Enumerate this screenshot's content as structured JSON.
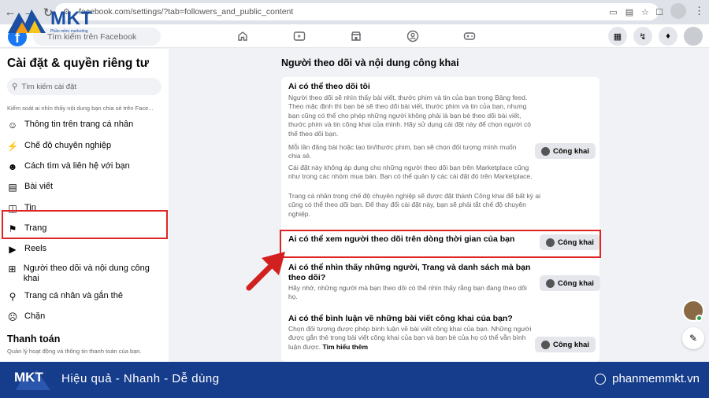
{
  "browser": {
    "url": "facebook.com/settings/?tab=followers_and_public_content",
    "nav_icons": [
      "back-arrow-icon",
      "forward-arrow-icon",
      "reload-icon"
    ]
  },
  "watermark": {
    "brand": "MKT",
    "sub": "Phần mềm marketing"
  },
  "fb_header": {
    "search_placeholder": "Tìm kiếm trên Facebook",
    "center_icons": [
      "home-icon",
      "video-icon",
      "marketplace-icon",
      "groups-icon",
      "gaming-icon"
    ],
    "right_icons": [
      "menu-grid-icon",
      "messenger-icon",
      "bell-icon"
    ]
  },
  "sidebar": {
    "title": "Cài đặt & quyền riêng tư",
    "search_placeholder": "Tìm kiếm cài đặt",
    "desc": "Kiểm soát ai nhìn thấy nội dung bạn chia sẻ trên Face...",
    "items": [
      {
        "label": "Thông tin trên trang cá nhân",
        "icon": "profile-icon"
      },
      {
        "label": "Chế độ chuyên nghiệp",
        "icon": "professional-icon"
      },
      {
        "label": "Cách tìm và liên hệ với bạn",
        "icon": "contact-icon"
      },
      {
        "label": "Bài viết",
        "icon": "posts-icon"
      },
      {
        "label": "Tin",
        "icon": "stories-icon"
      },
      {
        "label": "Trang",
        "icon": "flag-icon"
      },
      {
        "label": "Reels",
        "icon": "reels-icon"
      },
      {
        "label": "Người theo dõi và nội dung công khai",
        "icon": "followers-icon"
      },
      {
        "label": "Trang cá nhân và gắn thẻ",
        "icon": "tag-icon"
      },
      {
        "label": "Chặn",
        "icon": "block-icon"
      }
    ],
    "section_title": "Thanh toán",
    "section_desc": "Quản lý hoạt động và thông tin thanh toán của bạn."
  },
  "main": {
    "title": "Người theo dõi và nội dung công khai",
    "public_label": "Công khai",
    "rows": [
      {
        "title": "Ai có thể theo dõi tôi",
        "paragraphs": [
          "Người theo dõi sẽ nhìn thấy bài viết, thước phim và tin của bạn trong Bảng feed. Theo mặc định thì bạn bè sẽ theo dõi bài viết, thước phim và tin của bạn, nhưng bạn cũng có thể cho phép những người không phải là bạn bè theo dõi bài viết, thước phim và tin công khai của mình. Hãy sử dụng cài đặt này để chọn người có thể theo dõi bạn.",
          "Mỗi lần đăng bài hoặc tạo tin/thước phim, bạn sẽ chọn đối tượng mình muốn chia sẻ.",
          "Cài đặt này không áp dụng cho những người theo dõi bạn trên Marketplace cũng như trong các nhóm mua bán. Bạn có thể quản lý các cài đặt đó trên Marketplace.",
          "Trang cá nhân trong chế độ chuyên nghiệp sẽ được đặt thành Công khai để bất kỳ ai cũng có thể theo dõi bạn. Để thay đổi cài đặt này, bạn sẽ phải tắt chế độ chuyên nghiệp."
        ]
      },
      {
        "title": "Ai có thể xem người theo dõi trên dòng thời gian của bạn"
      },
      {
        "title": "Ai có thể nhìn thấy những người, Trang và danh sách mà bạn theo dõi?",
        "paragraph": "Hãy nhớ, những người mà bạn theo dõi có thể nhìn thấy rằng bạn đang theo dõi họ."
      },
      {
        "title": "Ai có thể bình luận về những bài viết công khai của bạn?",
        "paragraph": "Chọn đối tượng được phép bình luận về bài viết công khai của bạn. Những người được gắn thẻ trong bài viết công khai của bạn và bạn bè của họ có thể vẫn bình luận được.",
        "link": "Tìm hiểu thêm"
      }
    ]
  },
  "banner": {
    "logo": "MKT",
    "tagline": "Hiệu quả - Nhanh  - Dễ dùng",
    "site": "phanmemmkt.vn"
  },
  "colors": {
    "highlight": "#e02424",
    "facebook_blue": "#1877f2",
    "banner_bg": "#163c8c"
  }
}
